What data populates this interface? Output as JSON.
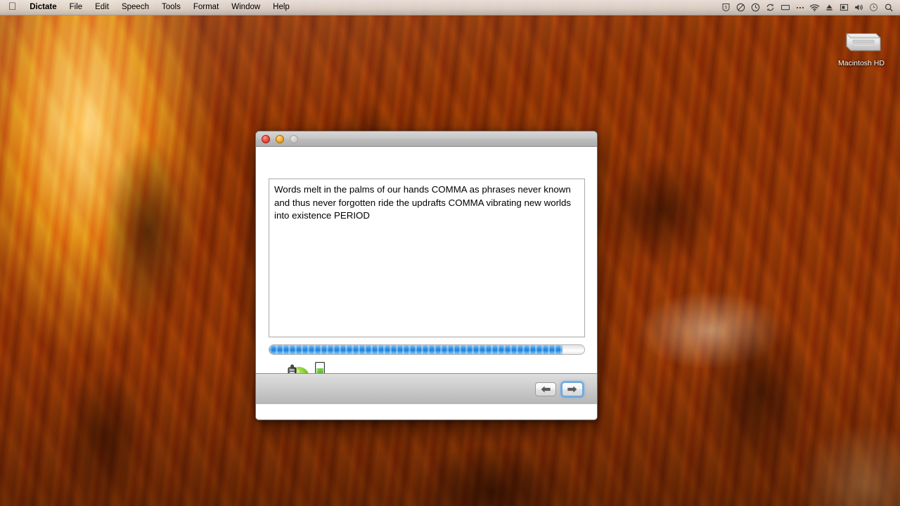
{
  "menubar": {
    "apple_icon": "apple-logo-icon",
    "items": [
      {
        "label": "Dictate",
        "bold": true
      },
      {
        "label": "File",
        "bold": false
      },
      {
        "label": "Edit",
        "bold": false
      },
      {
        "label": "Speech",
        "bold": false
      },
      {
        "label": "Tools",
        "bold": false
      },
      {
        "label": "Format",
        "bold": false
      },
      {
        "label": "Window",
        "bold": false
      },
      {
        "label": "Help",
        "bold": false
      }
    ],
    "status_icons": [
      "shield-badge-icon",
      "circle-slash-icon",
      "clock-icon",
      "sync-refresh-icon",
      "display-monitor-icon",
      "ellipsis-icon",
      "wifi-icon",
      "eject-icon",
      "input-source-icon",
      "volume-icon",
      "time-machine-icon",
      "spotlight-search-icon"
    ]
  },
  "desktop": {
    "hard_drive": {
      "label": "Macintosh HD",
      "icon": "hard-drive-icon"
    }
  },
  "window": {
    "title": "",
    "traffic_lights": {
      "close": "close-button",
      "minimize": "minimize-button",
      "zoom": "zoom-button"
    },
    "transcript": {
      "text": "Words melt in the palms of our hands COMMA as phrases never known and thus never forgotten ride the updrafts COMMA vibrating new worlds into existence PERIOD",
      "placeholder": ""
    },
    "progress": {
      "value": 93,
      "max": 100,
      "fill_percent": "93%",
      "accent_color": "#1d7ed8"
    },
    "microphone": {
      "state": "active",
      "indicator_color": "#7dc832",
      "level_meter_top_color": "#ffffff",
      "level_meter_green": "#3fa81e",
      "level_meter_red": "#b8452a"
    },
    "toolbar": {
      "back_label": "←",
      "forward_label": "→",
      "back_name": "back-button",
      "forward_name": "forward-button",
      "forward_focused": true
    }
  }
}
